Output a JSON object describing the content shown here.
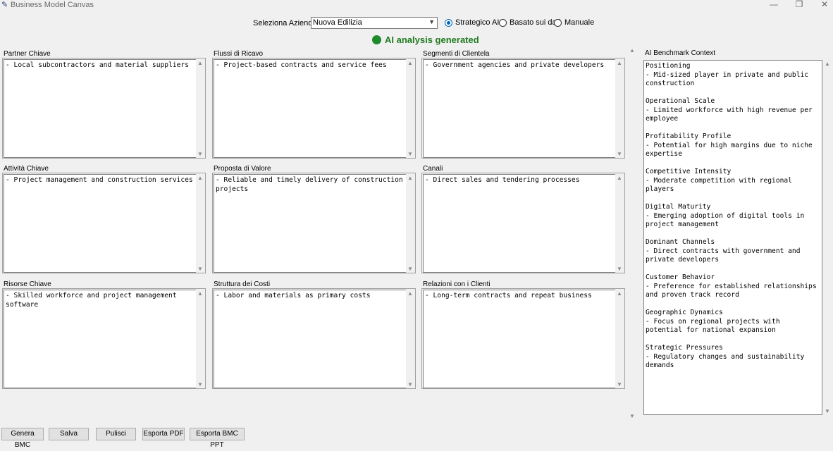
{
  "window": {
    "title": "Business Model Canvas",
    "controls": [
      "—",
      "❐",
      "✕"
    ]
  },
  "top": {
    "select_label": "Seleziona Azienda",
    "company": "Nuova Edilizia",
    "radios": [
      {
        "label": "Strategico AI",
        "selected": true
      },
      {
        "label": "Basato sui dati",
        "selected": false
      },
      {
        "label": "Manuale",
        "selected": false
      }
    ],
    "status": "AI analysis generated",
    "status_color": "#1f8a2a"
  },
  "boxes": {
    "partner": {
      "title": "Partner Chiave",
      "text": "- Local subcontractors and material suppliers"
    },
    "flussi": {
      "title": "Flussi di Ricavo",
      "text": "- Project-based contracts and service fees"
    },
    "segmenti": {
      "title": "Segmenti di Clientela",
      "text": "- Government agencies and private developers"
    },
    "attivita": {
      "title": "Attività Chiave",
      "text": "- Project management and construction services"
    },
    "proposta": {
      "title": "Proposta di Valore",
      "text": "- Reliable and timely delivery of construction projects"
    },
    "canali": {
      "title": "Canali",
      "text": "- Direct sales and tendering processes"
    },
    "risorse": {
      "title": "Risorse Chiave",
      "text": "- Skilled workforce and project management software"
    },
    "costi": {
      "title": "Struttura dei Costi",
      "text": "- Labor and materials as primary costs"
    },
    "relazioni": {
      "title": "Relazioni con i Clienti",
      "text": "- Long-term contracts and repeat business"
    }
  },
  "context": {
    "title": "AI Benchmark Context",
    "text": "Positioning\n- Mid-sized player in private and public construction\n\nOperational Scale\n- Limited workforce with high revenue per employee\n\nProfitability Profile\n- Potential for high margins due to niche expertise\n\nCompetitive Intensity\n- Moderate competition with regional players\n\nDigital Maturity\n- Emerging adoption of digital tools in project management\n\nDominant Channels\n- Direct contracts with government and private developers\n\nCustomer Behavior\n- Preference for established relationships and proven track record\n\nGeographic Dynamics\n- Focus on regional projects with potential for national expansion\n\nStrategic Pressures\n- Regulatory changes and sustainability demands"
  },
  "buttons": [
    "Genera BMC",
    "Salva",
    "Pulisci",
    "Esporta PDF",
    "Esporta BMC PPT"
  ]
}
